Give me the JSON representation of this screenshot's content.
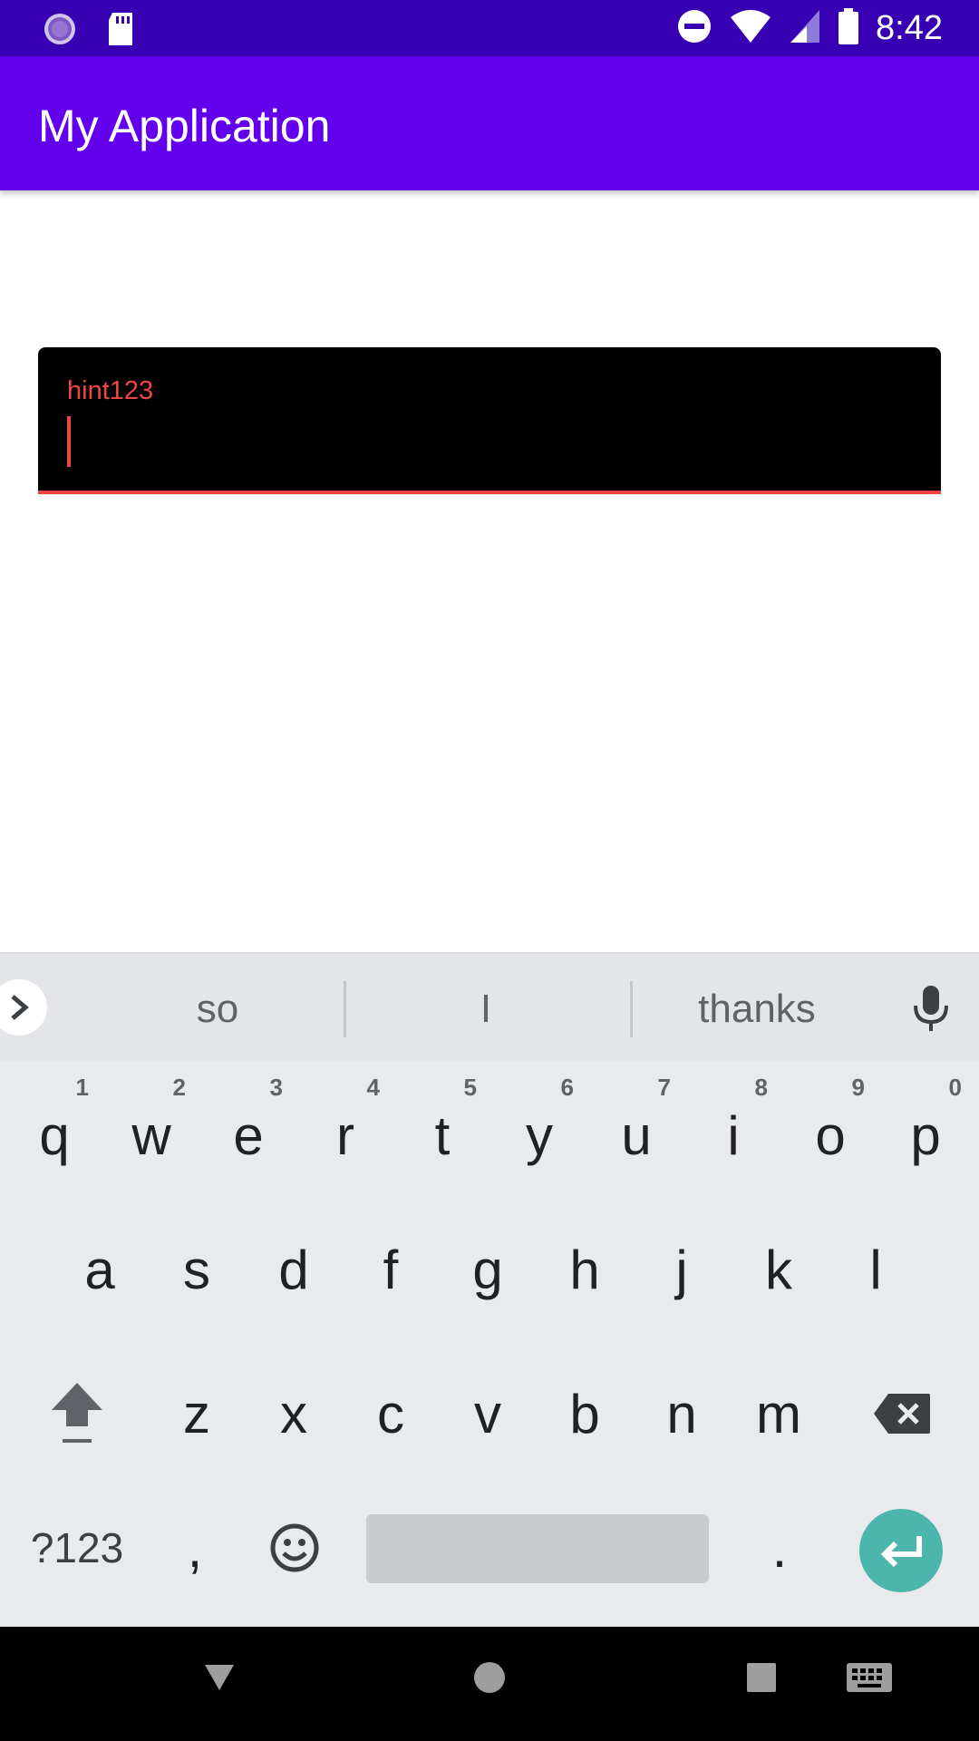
{
  "status_bar": {
    "time": "8:42",
    "left_icons": [
      "sync-icon",
      "sd-card-icon"
    ],
    "right_icons": [
      "do-not-disturb-icon",
      "wifi-icon",
      "signal-icon",
      "battery-icon"
    ]
  },
  "app_bar": {
    "title": "My Application"
  },
  "text_field": {
    "label": "hint123",
    "value": ""
  },
  "keyboard": {
    "suggestions": [
      "so",
      "I",
      "thanks"
    ],
    "row1": [
      {
        "key": "q",
        "hint": "1"
      },
      {
        "key": "w",
        "hint": "2"
      },
      {
        "key": "e",
        "hint": "3"
      },
      {
        "key": "r",
        "hint": "4"
      },
      {
        "key": "t",
        "hint": "5"
      },
      {
        "key": "y",
        "hint": "6"
      },
      {
        "key": "u",
        "hint": "7"
      },
      {
        "key": "i",
        "hint": "8"
      },
      {
        "key": "o",
        "hint": "9"
      },
      {
        "key": "p",
        "hint": "0"
      }
    ],
    "row2": [
      "a",
      "s",
      "d",
      "f",
      "g",
      "h",
      "j",
      "k",
      "l"
    ],
    "row3": [
      "z",
      "x",
      "c",
      "v",
      "b",
      "n",
      "m"
    ],
    "symbols_label": "?123",
    "comma": ",",
    "period": "."
  },
  "nav_bar": {
    "icons": [
      "back-icon",
      "home-icon",
      "recents-icon",
      "keyboard-switch-icon"
    ]
  },
  "colors": {
    "status_bar": "#3700B3",
    "app_bar": "#6200EE",
    "accent_error": "#EF4444",
    "enter_key": "#4DB6AC"
  }
}
